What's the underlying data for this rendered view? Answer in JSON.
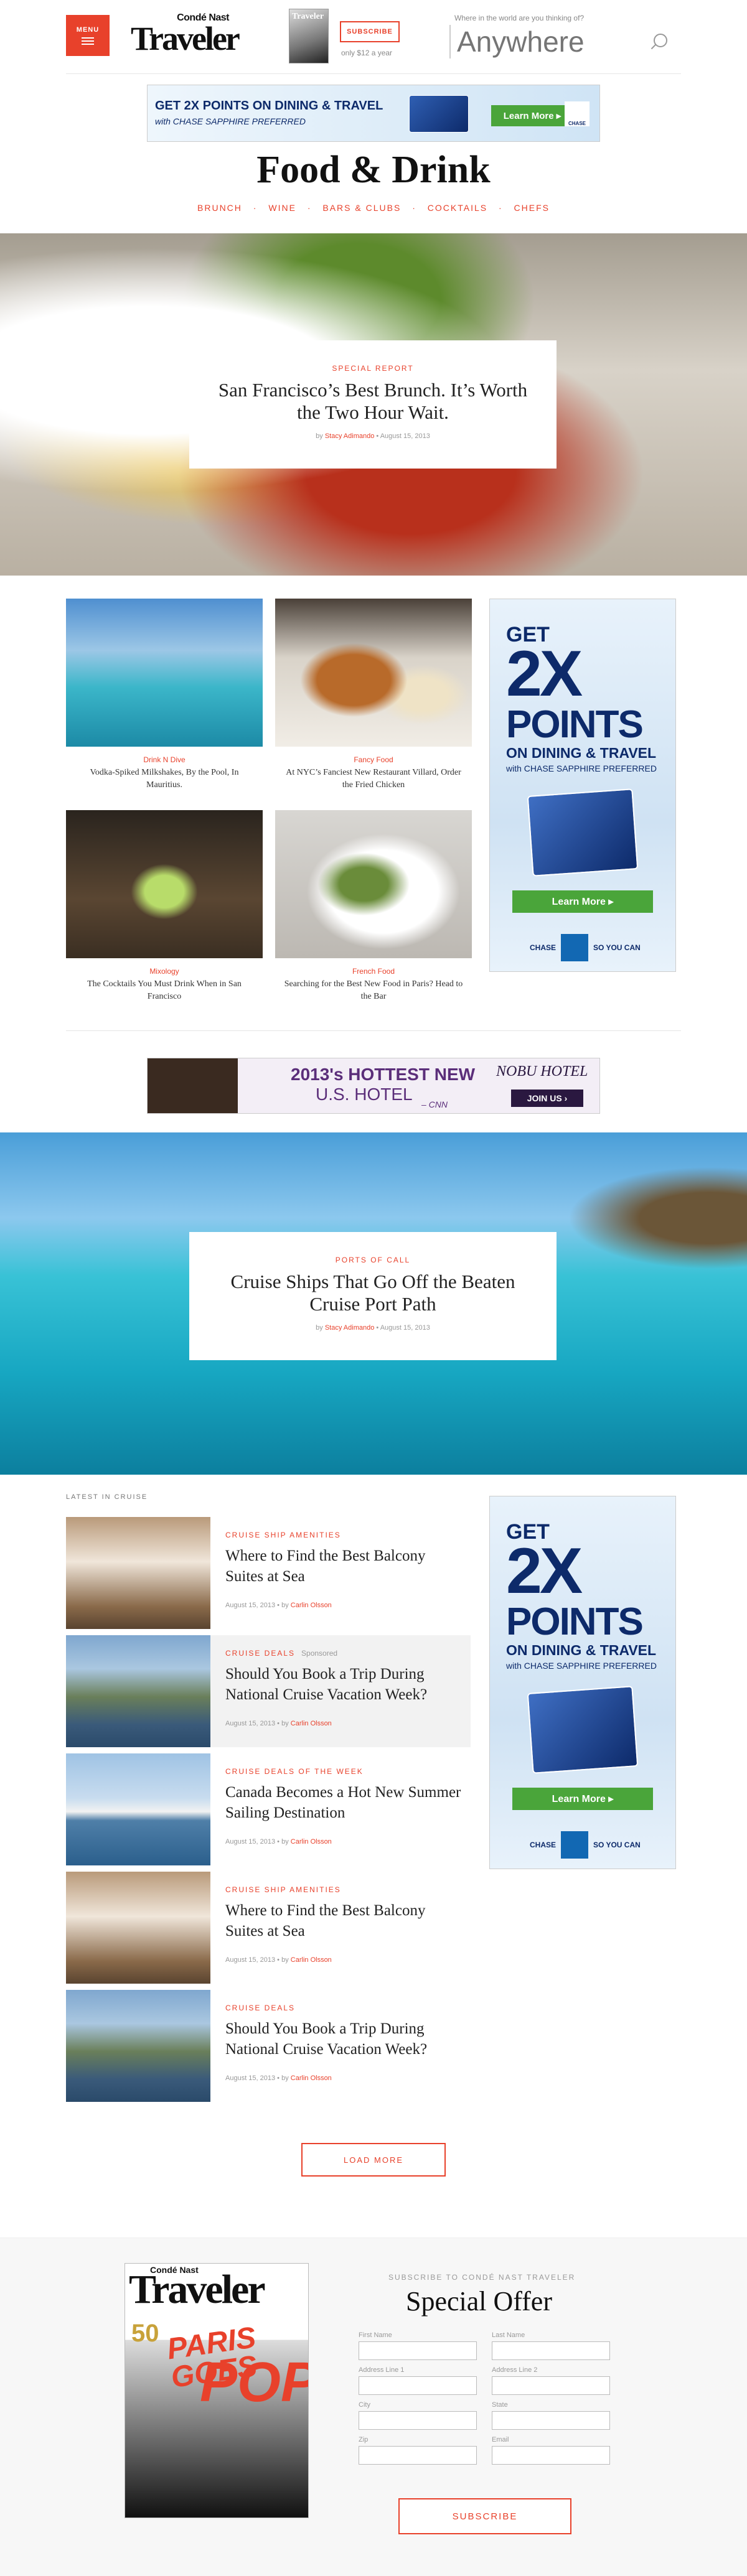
{
  "header": {
    "menu_label": "MENU",
    "logo_top": "Condé Nast",
    "logo_main": "Traveler",
    "mag_thumb_text": "Traveler",
    "subscribe_label": "SUBSCRIBE",
    "subscribe_price": "only $12 a year",
    "search_hint": "Where in the world are you thinking of?",
    "search_placeholder": "Anywhere"
  },
  "ad_top": {
    "line1": "GET 2X POINTS ON DINING & TRAVEL",
    "line2": "with CHASE SAPPHIRE PREFERRED",
    "button": "Learn More ▸",
    "brand": "CHASE"
  },
  "page": {
    "title": "Food & Drink",
    "subnav": [
      "BRUNCH",
      "·",
      "WINE",
      "·",
      "BARS & CLUBS",
      "·",
      "COCKTAILS",
      "·",
      "CHEFS"
    ]
  },
  "hero_food": {
    "kicker": "SPECIAL REPORT",
    "headline": "San Francisco’s Best Brunch. It’s Worth the Two Hour Wait.",
    "by": "by",
    "author": "Stacy Adimando",
    "date": "August 15, 2013"
  },
  "grid": [
    {
      "category": "Drink N Dive",
      "title": "Vodka-Spiked Milkshakes, By the Pool, In Mauritius."
    },
    {
      "category": "Fancy Food",
      "title": "At NYC’s Fanciest New Restaurant Villard, Order the Fried Chicken"
    },
    {
      "category": "Mixology",
      "title": "The Cocktails You Must Drink When in San Francisco"
    },
    {
      "category": "French Food",
      "title": "Searching for the Best New Food in Paris? Head to the Bar"
    }
  ],
  "ad_sky": {
    "get": "GET",
    "twox": "2X",
    "points": "POINTS",
    "dining": "ON DINING & TRAVEL",
    "with": "with CHASE SAPPHIRE PREFERRED",
    "button": "Learn More ▸",
    "brand": "CHASE",
    "tagline": "SO YOU CAN"
  },
  "ad_hotel": {
    "line1": "2013's HOTTEST NEW",
    "line2": "U.S. HOTEL",
    "source": "– CNN",
    "brand": "NOBU HOTEL",
    "button": "JOIN US ›"
  },
  "hero_sea": {
    "kicker": "PORTS OF CALL",
    "headline": "Cruise Ships That Go Off the Beaten Cruise Port Path",
    "by": "by",
    "author": "Stacy Adimando",
    "date": "August 15, 2013"
  },
  "latest": {
    "label": "LATEST IN CRUISE",
    "items": [
      {
        "kicker": "CRUISE SHIP AMENITIES",
        "sponsored": "",
        "title": "Where to Find the Best Balcony Suites at Sea",
        "date": "August 15, 2013",
        "by": "by",
        "author": "Carlin Olsson"
      },
      {
        "kicker": "CRUISE DEALS",
        "sponsored": "Sponsored",
        "title": "Should You Book a Trip During National Cruise Vacation Week?",
        "date": "August 15, 2013",
        "by": "by",
        "author": "Carlin Olsson"
      },
      {
        "kicker": "CRUISE DEALS OF THE WEEK",
        "sponsored": "",
        "title": "Canada Becomes a Hot New Summer Sailing Destination",
        "date": "August 15, 2013",
        "by": "by",
        "author": "Carlin Olsson"
      },
      {
        "kicker": "CRUISE SHIP AMENITIES",
        "sponsored": "",
        "title": "Where to Find the Best Balcony Suites at Sea",
        "date": "August 15, 2013",
        "by": "by",
        "author": "Carlin Olsson"
      },
      {
        "kicker": "CRUISE DEALS",
        "sponsored": "",
        "title": "Should You Book a Trip During National Cruise Vacation Week?",
        "date": "August 15, 2013",
        "by": "by",
        "author": "Carlin Olsson"
      }
    ],
    "load_more": "LOAD MORE"
  },
  "subscribe": {
    "kicker": "SUBSCRIBE TO CONDÉ NAST TRAVELER",
    "title": "Special Offer",
    "cover_top": "Condé Nast",
    "cover_mast": "Traveler",
    "cover_paris": "PARIS GOES",
    "cover_pop": "POP!",
    "cover_num": "50",
    "fields": {
      "first_name": "First Name",
      "last_name": "Last Name",
      "address1": "Address Line 1",
      "address2": "Address Line 2",
      "city": "City",
      "state": "State",
      "zip": "Zip",
      "email": "Email"
    },
    "button": "SUBSCRIBE"
  },
  "colors": {
    "accent": "#e8412b",
    "chase_blue": "#0d2a6a",
    "chase_green": "#4aa53a"
  }
}
